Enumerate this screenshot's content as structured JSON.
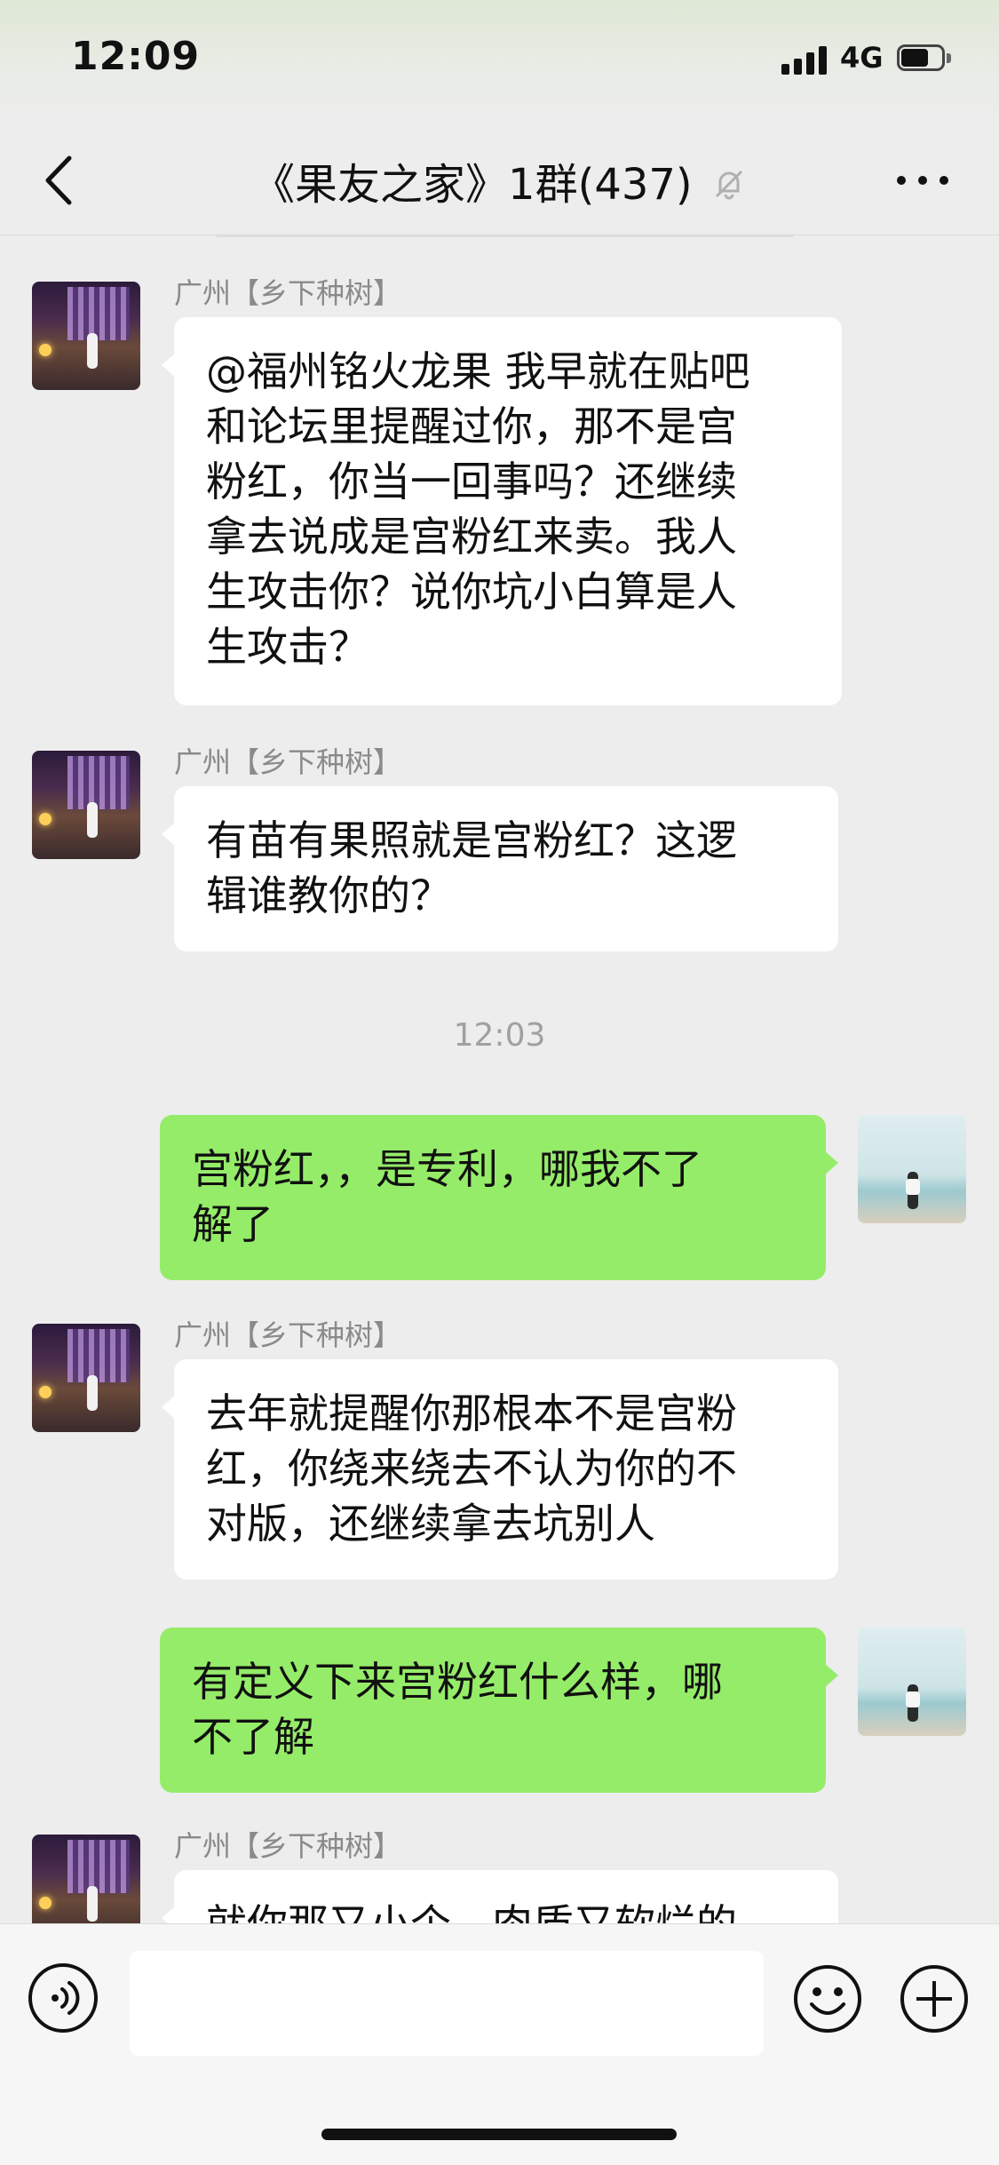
{
  "status_bar": {
    "time": "12:09",
    "network": "4G",
    "icons": [
      "signal-icon",
      "battery-icon"
    ]
  },
  "nav": {
    "title": "《果友之家》1群(437)",
    "icons": [
      "back-icon",
      "mute-bell-icon",
      "more-icon"
    ]
  },
  "chat": {
    "timestamp": "12:03",
    "messages": [
      {
        "direction": "in",
        "sender": "广州【乡下种树】",
        "lines": [
          "@福州铭火龙果 我早就在贴吧",
          "和论坛里提醒过你，那不是宫",
          "粉红，你当一回事吗？还继续",
          "拿去说成是宫粉红来卖。我人",
          "生攻击你？说你坑小白算是人",
          "生攻击？"
        ]
      },
      {
        "direction": "in",
        "sender": "广州【乡下种树】",
        "lines": [
          "有苗有果照就是宫粉红？这逻",
          "辑谁教你的？"
        ]
      },
      {
        "direction": "out",
        "lines": [
          "宫粉红，，是专利，哪我不了",
          "解了"
        ]
      },
      {
        "direction": "in",
        "sender": "广州【乡下种树】",
        "lines": [
          "去年就提醒你那根本不是宫粉",
          "红，你绕来绕去不认为你的不",
          "对版，还继续拿去坑别人"
        ]
      },
      {
        "direction": "out",
        "lines": [
          "有定义下来宫粉红什么样，哪",
          "不了解"
        ]
      },
      {
        "direction": "in",
        "sender": "广州【乡下种树】",
        "lines": [
          "就你那又小个，肉质又软烂的"
        ]
      }
    ]
  },
  "input_bar": {
    "message_value": "",
    "icons": [
      "voice-icon",
      "emoji-icon",
      "plus-icon"
    ]
  }
}
